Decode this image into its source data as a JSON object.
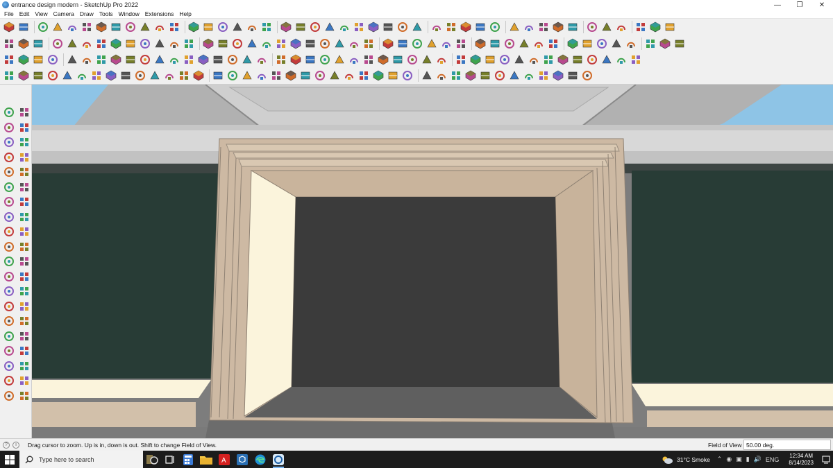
{
  "window": {
    "title": "entrance design modern - SketchUp Pro 2022",
    "minimize": "—",
    "restore": "❐",
    "close": "✕"
  },
  "menu": [
    "File",
    "Edit",
    "View",
    "Camera",
    "Draw",
    "Tools",
    "Window",
    "Extensions",
    "Help"
  ],
  "statusbar": {
    "hint": "Drag cursor to zoom.  Up is in, down is out. Shift to change Field of View.",
    "vcb_label": "Field of View",
    "vcb_value": "50.00 deg."
  },
  "taskbar": {
    "search_placeholder": "Type here to search",
    "weather": "31°C  Smoke",
    "language": "ENG",
    "time": "12:34 AM",
    "date": "8/14/2023"
  },
  "colors": {
    "sky": "#8ec4e6",
    "frame": "#cdb9a3",
    "frame_light": "#fbf4dc",
    "glass": "#283c36",
    "opening": "#3b3b3b",
    "floor": "#6c6c6c",
    "toolbar_bg": "#f0f0f0",
    "taskbar_bg": "#1c1c1c"
  }
}
